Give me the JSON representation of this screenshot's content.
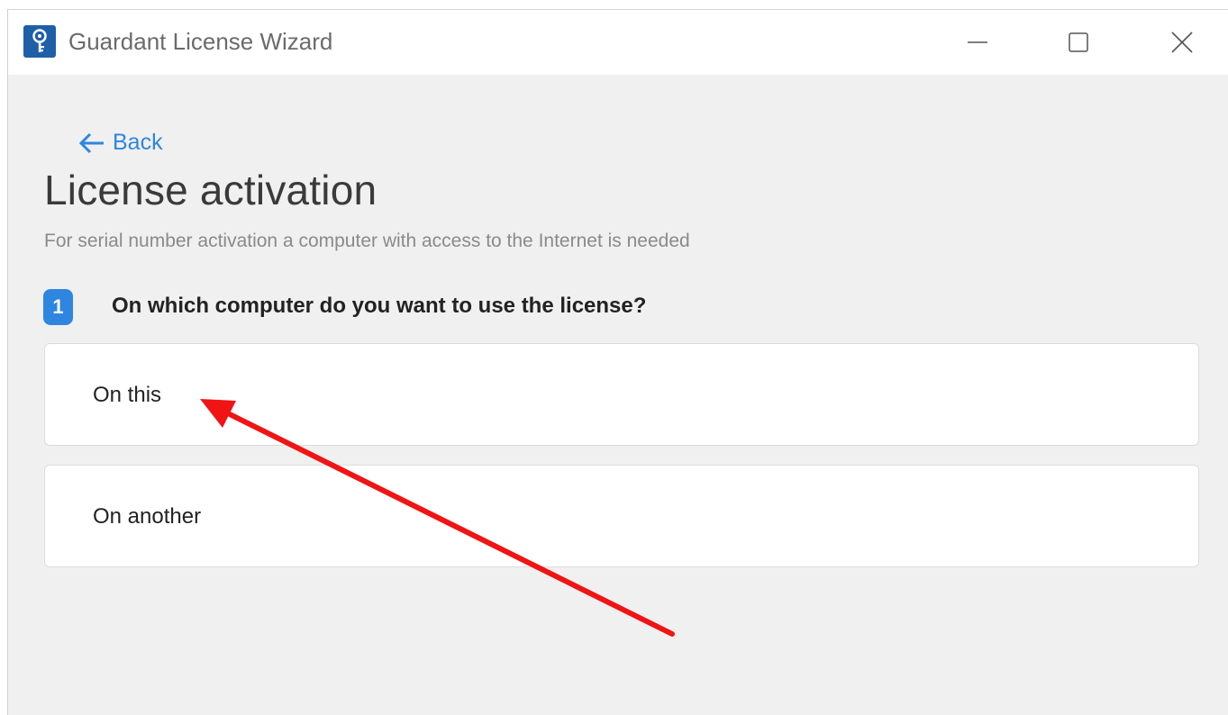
{
  "window": {
    "title": "Guardant License Wizard",
    "icon": "key-icon"
  },
  "controls": {
    "minimize_icon": "minimize-icon",
    "maximize_icon": "maximize-icon",
    "close_icon": "close-icon"
  },
  "nav": {
    "back_label": "Back",
    "back_icon": "arrow-left-icon"
  },
  "page": {
    "title": "License activation",
    "subtitle": "For serial number activation a computer with access to the Internet is needed"
  },
  "step": {
    "number": "1",
    "question": "On which computer do you want to use the license?"
  },
  "options": [
    {
      "label": "On this"
    },
    {
      "label": "On another"
    }
  ],
  "colors": {
    "accent": "#2f86e0",
    "annotation_arrow": "#f01414",
    "background": "#f0f0f0"
  }
}
